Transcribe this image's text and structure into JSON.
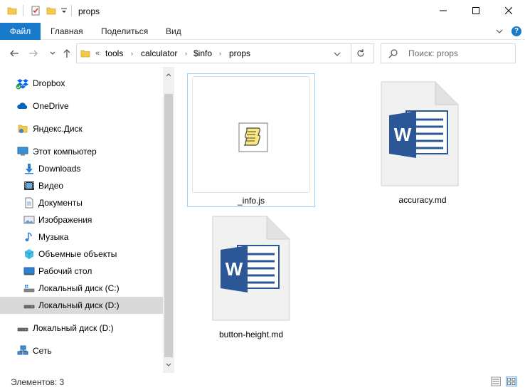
{
  "window": {
    "title": "props",
    "minimize_label": "—",
    "maximize_label": "☐",
    "close_label": "✕"
  },
  "ribbon": {
    "tabs": [
      {
        "label": "Файл"
      },
      {
        "label": "Главная"
      },
      {
        "label": "Поделиться"
      },
      {
        "label": "Вид"
      }
    ],
    "help_label": "?"
  },
  "navigation": {
    "address_prefix": "«",
    "breadcrumbs": [
      "tools",
      "calculator",
      "$info",
      "props"
    ],
    "search_placeholder": "Поиск: props"
  },
  "sidebar": {
    "items": [
      {
        "label": "Dropbox",
        "icon": "dropbox-icon"
      },
      {
        "label": "OneDrive",
        "icon": "onedrive-icon"
      },
      {
        "label": "Яндекс.Диск",
        "icon": "yandex-disk-icon"
      },
      {
        "label": "Этот компьютер",
        "icon": "computer-icon"
      },
      {
        "label": "Downloads",
        "icon": "downloads-icon"
      },
      {
        "label": "Видео",
        "icon": "video-icon"
      },
      {
        "label": "Документы",
        "icon": "documents-icon"
      },
      {
        "label": "Изображения",
        "icon": "pictures-icon"
      },
      {
        "label": "Музыка",
        "icon": "music-icon"
      },
      {
        "label": "Объемные объекты",
        "icon": "3d-objects-icon"
      },
      {
        "label": "Рабочий стол",
        "icon": "desktop-icon"
      },
      {
        "label": "Локальный диск (C:)",
        "icon": "local-disk-c-icon"
      },
      {
        "label": "Локальный диск (D:)",
        "icon": "local-disk-d-icon",
        "selected": true
      },
      {
        "label": "Локальный диск (D:)",
        "icon": "local-disk-d-icon"
      },
      {
        "label": "Сеть",
        "icon": "network-icon"
      }
    ]
  },
  "files": [
    {
      "name": "_info.js",
      "icon": "js-script-icon",
      "selected": true
    },
    {
      "name": "accuracy.md",
      "icon": "word-document-icon"
    },
    {
      "name": "button-height.md",
      "icon": "word-document-icon"
    }
  ],
  "status": {
    "items_count": "Элементов: 3"
  },
  "colors": {
    "accent": "#1979ca",
    "selection_border": "#99d1ff",
    "sidebar_selected": "#d9d9d9",
    "word_blue": "#2b5797"
  }
}
